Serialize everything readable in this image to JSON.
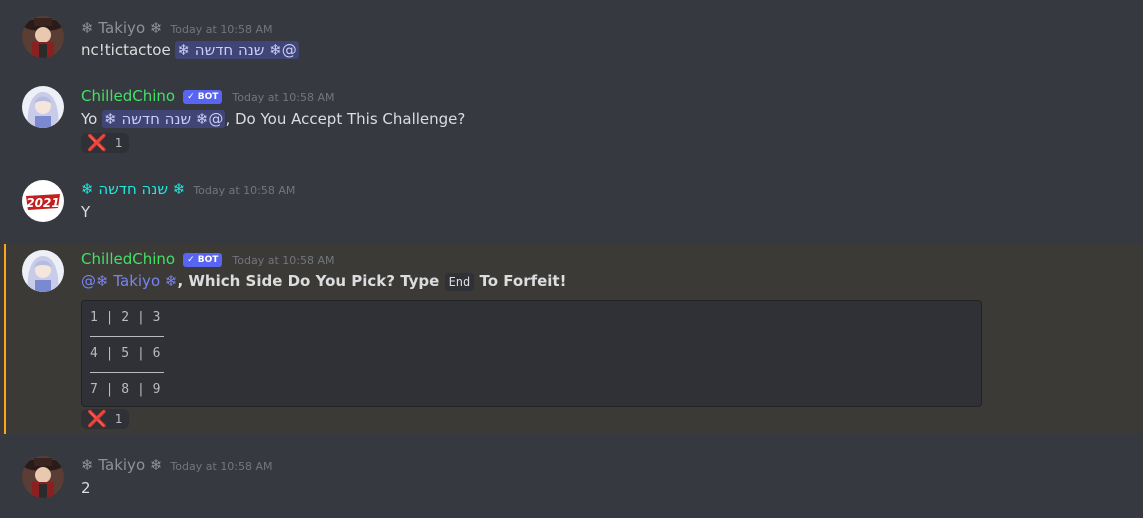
{
  "messages": [
    {
      "username": "❄ Takiyo ❄",
      "timestamp": "Today at 10:58 AM",
      "text_prefix": "nc!tictactoe ",
      "mention": "❄ שנה חדשה ❄@"
    },
    {
      "username": "ChilledChino",
      "bot_tag": "✓ BOT",
      "timestamp": "Today at 10:58 AM",
      "text_prefix": "Yo ",
      "mention": "❄ שנה חדשה ❄@",
      "text_suffix": ", Do You Accept This Challenge?",
      "reaction": {
        "emoji": "❌",
        "count": "1"
      }
    },
    {
      "username": "❄ שנה חדשה ❄",
      "avatar_text": "2021",
      "timestamp": "Today at 10:58 AM",
      "text": "Y"
    },
    {
      "username": "ChilledChino",
      "bot_tag": "✓ BOT",
      "timestamp": "Today at 10:58 AM",
      "mention": "@❄ Takiyo ❄",
      "text_middle": ", Which Side Do You Pick? Type ",
      "code": "End",
      "text_suffix": " To Forfeit!",
      "board": [
        "1 | 2 | 3",
        "4 | 5 | 6",
        "7 | 8 | 9"
      ],
      "reaction": {
        "emoji": "❌",
        "count": "1"
      }
    },
    {
      "username": "❄ Takiyo ❄",
      "timestamp": "Today at 10:58 AM",
      "text": "2"
    }
  ],
  "colors": {
    "background": "#36393f",
    "highlight_bar": "#faa81a",
    "bot_tag": "#5865f2",
    "username_bot": "#43e068",
    "username_cyan": "#1ee8e0",
    "mention": "#7983f5"
  }
}
